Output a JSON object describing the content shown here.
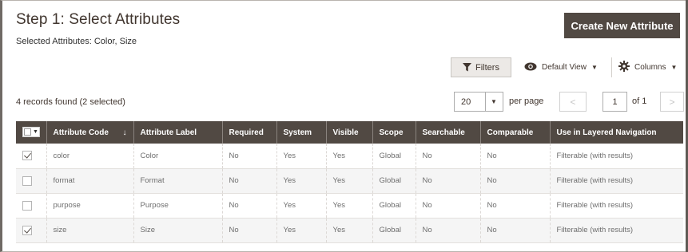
{
  "header": {
    "title": "Step 1: Select Attributes",
    "subtitle": "Selected Attributes: Color, Size",
    "create_label": "Create New Attribute"
  },
  "toolbar": {
    "filters_label": "Filters",
    "view_label": "Default View",
    "columns_label": "Columns",
    "icons": {
      "filters": "funnel-icon",
      "view": "eye-icon",
      "columns": "gear-icon"
    }
  },
  "records": {
    "summary": "4 records found (2 selected)"
  },
  "pagination": {
    "per_page_value": "20",
    "per_page_label": "per page",
    "current_page": "1",
    "of_label": "of 1",
    "prev": "<",
    "next": ">"
  },
  "table": {
    "columns": [
      "Attribute Code",
      "Attribute Label",
      "Required",
      "System",
      "Visible",
      "Scope",
      "Searchable",
      "Comparable",
      "Use in Layered Navigation"
    ],
    "sort_indicator": "↓",
    "rows": [
      {
        "checked": true,
        "cells": [
          "color",
          "Color",
          "No",
          "Yes",
          "Yes",
          "Global",
          "No",
          "No",
          "Filterable (with results)"
        ]
      },
      {
        "checked": false,
        "cells": [
          "format",
          "Format",
          "No",
          "Yes",
          "Yes",
          "Global",
          "No",
          "No",
          "Filterable (with results)"
        ]
      },
      {
        "checked": false,
        "cells": [
          "purpose",
          "Purpose",
          "No",
          "Yes",
          "Yes",
          "Global",
          "No",
          "No",
          "Filterable (with results)"
        ]
      },
      {
        "checked": true,
        "cells": [
          "size",
          "Size",
          "No",
          "Yes",
          "Yes",
          "Global",
          "No",
          "No",
          "Filterable (with results)"
        ]
      }
    ]
  },
  "colors": {
    "header_bg": "#514943",
    "button_bg": "#514943",
    "text": "#41362f",
    "alt_row": "#f5f5f5"
  }
}
